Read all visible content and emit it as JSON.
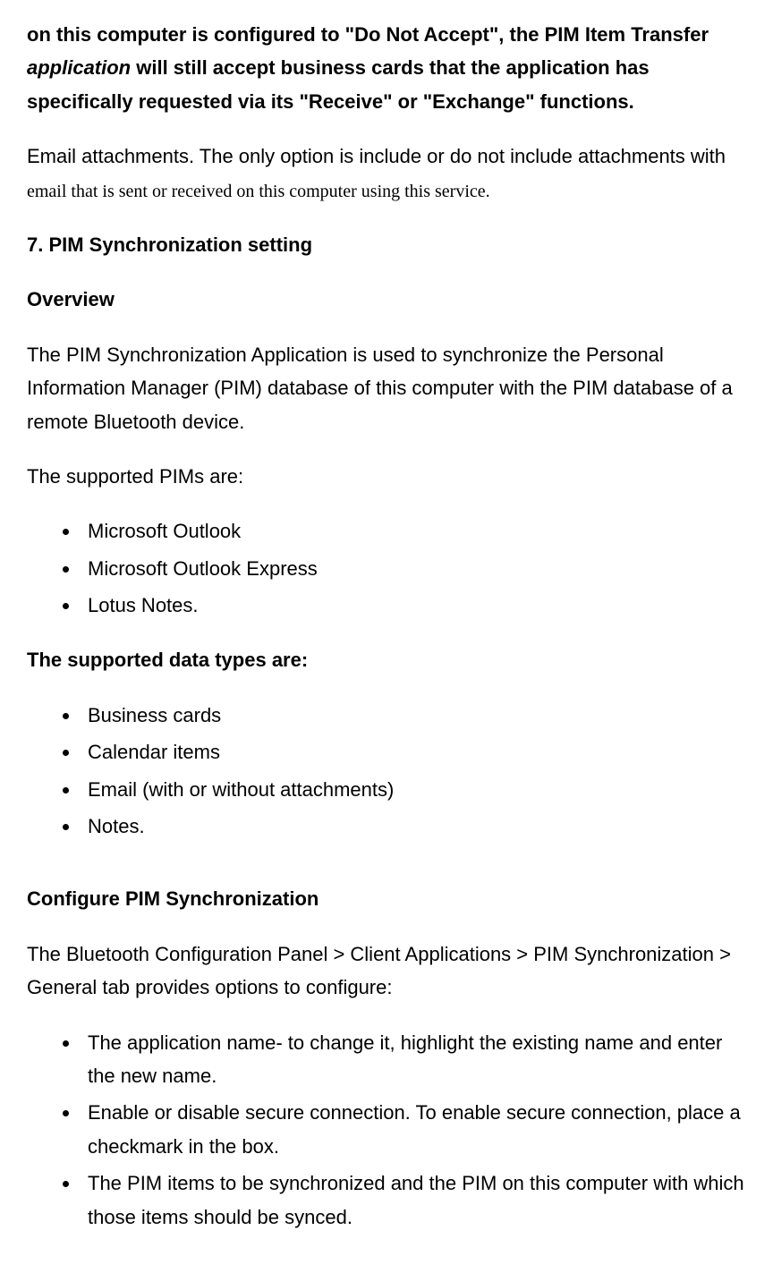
{
  "intro_bold_part1": "on this computer is configured to \"Do Not Accept\", the PIM Item Transfer ",
  "intro_bold_italic": "application",
  "intro_bold_part2": " will still accept business cards that the application has specifically requested via its \"Receive\" or \"Exchange\" functions.",
  "email_para_part1": "Email attachments. The only option is include or do not include attachments with ",
  "email_para_serif": "email that is sent or received on this computer using this service.",
  "h_pim_sync": "7. PIM Synchronization setting",
  "h_overview": "Overview",
  "overview_para": "The PIM Synchronization Application is used to synchronize the Personal Information Manager (PIM) database of this computer with the PIM database of a remote Bluetooth device.",
  "supported_pims_intro": "The supported PIMs are:",
  "pims": [
    "Microsoft Outlook",
    "Microsoft Outlook Express",
    "Lotus Notes."
  ],
  "h_supported_data": "The supported data types are:",
  "data_types": [
    "Business cards",
    "Calendar items",
    "Email (with or without attachments)",
    "Notes."
  ],
  "h_configure": "Configure PIM Synchronization",
  "configure_para": "The Bluetooth Configuration Panel > Client Applications > PIM Synchronization > General tab provides options to configure:",
  "config_items": [
    "The application name- to change it, highlight the existing name and enter the new name.",
    "Enable or disable secure connection. To enable secure connection, place a checkmark in the box.",
    "The PIM items to be synchronized and the PIM on this computer with which those items should be synced."
  ]
}
